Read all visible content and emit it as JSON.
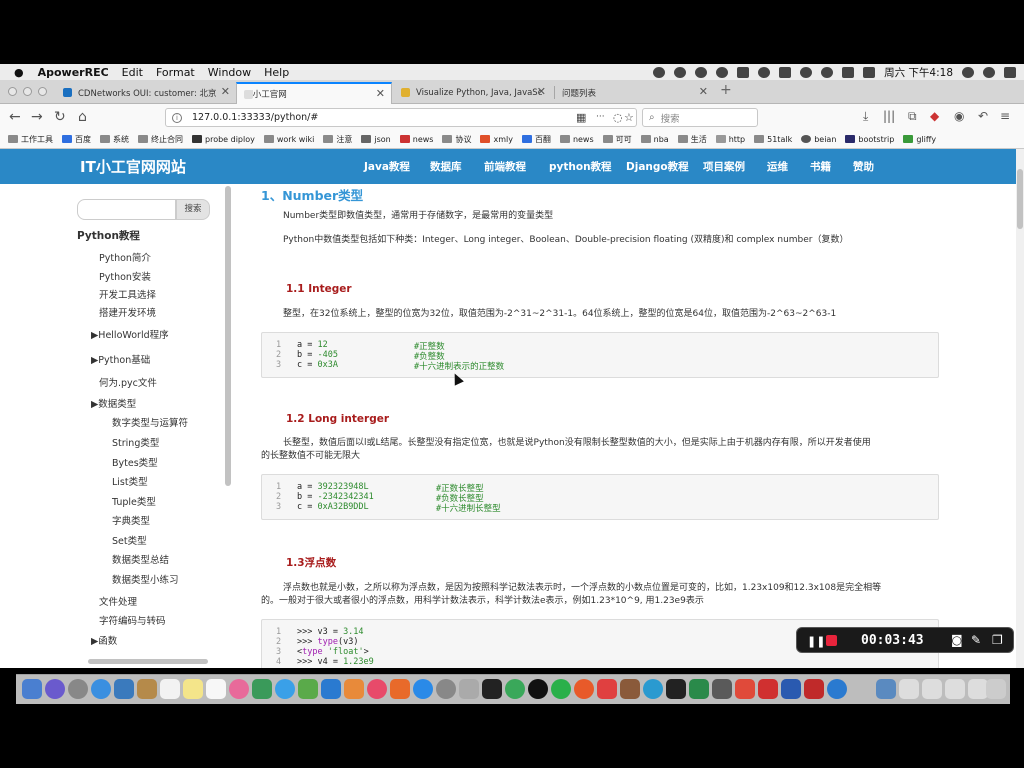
{
  "menubar": {
    "app": "ApowerREC",
    "items": [
      "Edit",
      "Format",
      "Window",
      "Help"
    ],
    "clock": "周六 下午4:18"
  },
  "tabs": [
    {
      "label": "CDNetworks OUI: customer: 北京",
      "active": false
    },
    {
      "label": "IT小工官网",
      "active": true
    },
    {
      "label": "Visualize Python, Java, JavaSc",
      "active": false
    },
    {
      "label": "问题列表",
      "active": false
    }
  ],
  "nav": {
    "url": "127.0.0.1:33333/python/#",
    "search_placeholder": "搜索",
    "more": "···"
  },
  "bookmarks": [
    "工作工具",
    "百度",
    "系统",
    "终止合同",
    "probe diploy",
    "work wiki",
    "注意",
    "json",
    "news",
    "协议",
    "xmly",
    "百翻",
    "news",
    "可可",
    "nba",
    "生活",
    "http",
    "51talk",
    "beian",
    "bootstrip",
    "gliffy"
  ],
  "site": {
    "title": "IT小工官网网站",
    "nav": [
      "Java教程",
      "数据库",
      "前端教程",
      "python教程",
      "Django教程",
      "项目案例",
      "运维",
      "书籍",
      "赞助"
    ]
  },
  "sidebar": {
    "search_button": "搜索",
    "heading": "Python教程",
    "items": [
      {
        "label": "Python简介",
        "level": 1
      },
      {
        "label": "Python安装",
        "level": 1
      },
      {
        "label": "开发工具选择",
        "level": 1
      },
      {
        "label": "搭建开发环境",
        "level": 1
      },
      {
        "label": "▶HelloWorld程序",
        "level": 0
      },
      {
        "label": "▶Python基础",
        "level": 0
      },
      {
        "label": "何为.pyc文件",
        "level": 1
      },
      {
        "label": "▶数据类型",
        "level": 0
      },
      {
        "label": "数字类型与运算符",
        "level": 2
      },
      {
        "label": "String类型",
        "level": 2
      },
      {
        "label": "Bytes类型",
        "level": 2
      },
      {
        "label": "List类型",
        "level": 2
      },
      {
        "label": "Tuple类型",
        "level": 2
      },
      {
        "label": "字典类型",
        "level": 2
      },
      {
        "label": "Set类型",
        "level": 2
      },
      {
        "label": "数据类型总结",
        "level": 2
      },
      {
        "label": "数据类型小练习",
        "level": 2
      },
      {
        "label": "文件处理",
        "level": 1
      },
      {
        "label": "字符编码与转码",
        "level": 1
      },
      {
        "label": "▶函数",
        "level": 0
      }
    ]
  },
  "article": {
    "h2": "1、Number类型",
    "p1": "Number类型即数值类型，通常用于存储数字，是最常用的变量类型",
    "p2": "Python中数值类型包括如下种类：Integer、Long integer、Boolean、Double-precision floating (双精度)和 complex number（复数）",
    "s1": {
      "title": "1.1 Integer",
      "text": "整型，在32位系统上，整型的位宽为32位，取值范围为-2^31~2^31-1。64位系统上，整型的位宽是64位，取值范围为-2^63~2^63-1",
      "code": [
        {
          "n": "1",
          "var": "a",
          "val": "12",
          "cmt": "#正整数"
        },
        {
          "n": "2",
          "var": "b",
          "val": "-405",
          "cmt": "#负整数"
        },
        {
          "n": "3",
          "var": "c",
          "val": "0x3A",
          "cmt": "#十六进制表示的正整数"
        }
      ]
    },
    "s2": {
      "title": "1.2 Long interger",
      "text1": "长整型，数值后面以l或L结尾。长整型没有指定位宽，也就是说Python没有限制长整型数值的大小，但是实际上由于机器内存有限，所以开发者使用",
      "text2": "的长整数值不可能无限大",
      "code": [
        {
          "n": "1",
          "var": "a",
          "val": "392323948L",
          "cmt": "#正数长整型"
        },
        {
          "n": "2",
          "var": "b",
          "val": "-2342342341",
          "cmt": "#负数长整型"
        },
        {
          "n": "3",
          "var": "c",
          "val": "0xA32B9DDL",
          "cmt": "#十六进制长整型"
        }
      ]
    },
    "s3": {
      "title": "1.3浮点数",
      "text1": "浮点数也就是小数，之所以称为浮点数，是因为按照科学记数法表示时，一个浮点数的小数点位置是可变的，比如，1.23x109和12.3x108是完全相等",
      "text2": "的。一般对于很大或者很小的浮点数，用科学计数法表示，科学计数法e表示，例如1.23*10^9, 用1.23e9表示",
      "code": [
        {
          "n": "1",
          "pre": ">>> v3 = ",
          "val": "3.14"
        },
        {
          "n": "2",
          "pre": ">>> ",
          "kw": "type",
          "post": "(v3)"
        },
        {
          "n": "3",
          "pre": "<",
          "kw": "type",
          "post": " ",
          "str": "'float'",
          "end": ">"
        },
        {
          "n": "4",
          "pre": ">>> v4 = ",
          "val": "1.23e9"
        }
      ]
    }
  },
  "recorder": {
    "time": "00:03:43"
  }
}
